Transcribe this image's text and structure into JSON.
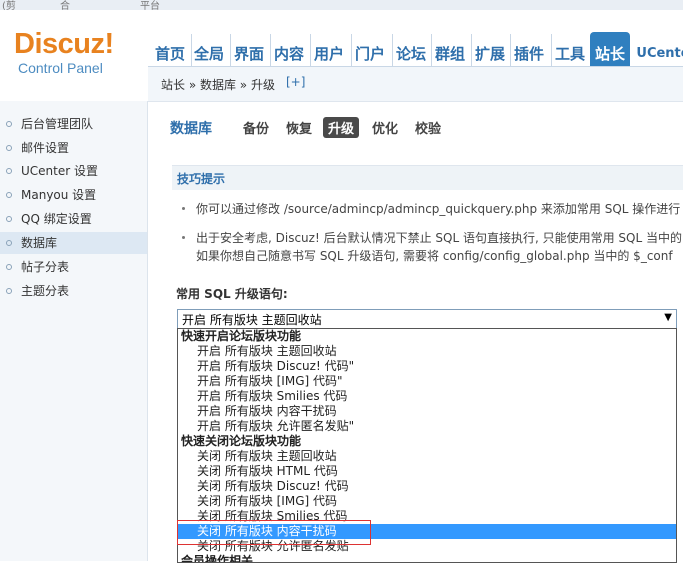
{
  "window": {
    "topstrip": [
      "(剪",
      "合",
      "平台"
    ]
  },
  "logo": {
    "name": "Discuz",
    "excl": "!",
    "subtitle": "Control Panel"
  },
  "nav": [
    {
      "label": "首页"
    },
    {
      "label": "全局"
    },
    {
      "label": "界面"
    },
    {
      "label": "内容"
    },
    {
      "label": "用户"
    },
    {
      "label": "门户"
    },
    {
      "label": "论坛"
    },
    {
      "label": "群组"
    },
    {
      "label": "扩展"
    },
    {
      "label": "插件"
    },
    {
      "label": "工具"
    },
    {
      "label": "站长",
      "active": true
    },
    {
      "label": "UCente"
    }
  ],
  "breadcrumb": {
    "text": "站长 » 数据库 » 升级",
    "plus": "[+]"
  },
  "sidebar": {
    "items": [
      {
        "label": "后台管理团队"
      },
      {
        "label": "邮件设置"
      },
      {
        "label": "UCenter 设置"
      },
      {
        "label": "Manyou 设置"
      },
      {
        "label": "QQ 绑定设置"
      },
      {
        "label": "数据库",
        "active": true
      },
      {
        "label": "帖子分表"
      },
      {
        "label": "主题分表"
      }
    ]
  },
  "page": {
    "title": "数据库",
    "tabs": [
      {
        "label": "备份"
      },
      {
        "label": "恢复"
      },
      {
        "label": "升级",
        "active": true
      },
      {
        "label": "优化"
      },
      {
        "label": "校验"
      }
    ]
  },
  "tips": {
    "heading": "技巧提示",
    "lines": [
      "你可以通过修改 /source/admincp/admincp_quickquery.php 来添加常用 SQL 操作进行",
      "出于安全考虑, Discuz! 后台默认情况下禁止 SQL 语句直接执行, 只能使用常用 SQL 当中的",
      "如果你想自己随意书写 SQL 升级语句, 需要将 config/config_global.php 当中的 $_conf"
    ]
  },
  "sql": {
    "label": "常用 SQL 升级语句:",
    "selected": "开启 所有版块 主题回收站",
    "arrow": "▼",
    "options": [
      {
        "text": "快速开启论坛版块功能",
        "group": true
      },
      {
        "text": "开启 所有版块 主题回收站"
      },
      {
        "text": "开启 所有版块 Discuz! 代码\""
      },
      {
        "text": "开启 所有版块 [IMG] 代码\""
      },
      {
        "text": "开启 所有版块 Smilies 代码"
      },
      {
        "text": "开启 所有版块 内容干扰码"
      },
      {
        "text": "开启 所有版块 允许匿名发贴\""
      },
      {
        "text": "快速关闭论坛版块功能",
        "group": true
      },
      {
        "text": "关闭 所有版块 主题回收站"
      },
      {
        "text": "关闭 所有版块 HTML 代码"
      },
      {
        "text": "关闭 所有版块 Discuz! 代码"
      },
      {
        "text": "关闭 所有版块 [IMG] 代码"
      },
      {
        "text": "关闭 所有版块 Smilies 代码"
      },
      {
        "text": "关闭 所有版块 内容干扰码",
        "selected": true
      },
      {
        "text": "关闭 所有版块 允许匿名发贴"
      },
      {
        "text": "会员操作相关",
        "group": true
      }
    ]
  },
  "colors": {
    "accent": "#2f6fab",
    "active_tab": "#2f7fbf",
    "selection": "#3399ff",
    "highlight_box": "#dd3333"
  }
}
